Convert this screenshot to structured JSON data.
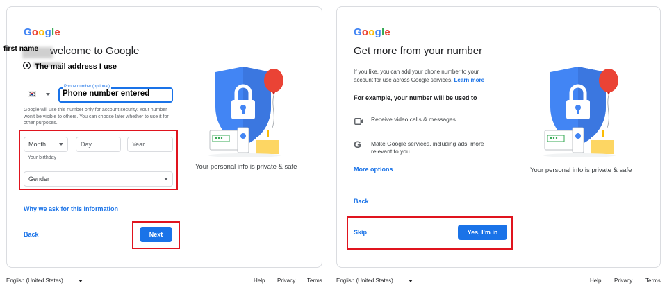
{
  "logo": {
    "letters": [
      "G",
      "o",
      "o",
      "g",
      "l",
      "e"
    ],
    "colors": [
      "#4285F4",
      "#EA4335",
      "#FBBC05",
      "#4285F4",
      "#34A853",
      "#EA4335"
    ]
  },
  "left": {
    "overlay_first_name": "first name",
    "title": "welcome to Google",
    "overlay_email": "The mail address I use",
    "country_flag": "🇰🇷",
    "phone_label": "Phone number (optional)",
    "phone_value": "Phone number entered",
    "phone_note": "Google will use this number only for account security. Your number won't be visible to others. You can choose later whether to use it for other purposes.",
    "month_label": "Month",
    "day_placeholder": "Day",
    "year_placeholder": "Year",
    "birthday_helper": "Your birthday",
    "gender_label": "Gender",
    "why_link": "Why we ask for this information",
    "back_label": "Back",
    "next_label": "Next",
    "privacy_caption": "Your personal info is private & safe"
  },
  "right": {
    "title": "Get more from your number",
    "intro": "If you like, you can add your phone number to your account for use across Google services.",
    "learn_more": "Learn more",
    "example_heading": "For example, your number will be used to",
    "feature_video": "Receive video calls & messages",
    "feature_services": "Make Google services, including ads, more relevant to you",
    "more_options": "More options",
    "back_label": "Back",
    "skip_label": "Skip",
    "yes_label": "Yes, I'm in",
    "privacy_caption": "Your personal info is private & safe"
  },
  "footer": {
    "language": "English (United States)",
    "help": "Help",
    "privacy": "Privacy",
    "terms": "Terms"
  },
  "colors": {
    "accent": "#1a73e8",
    "highlight": "#e0141e",
    "shield": "#4285F4",
    "balloon": "#EA4335"
  }
}
